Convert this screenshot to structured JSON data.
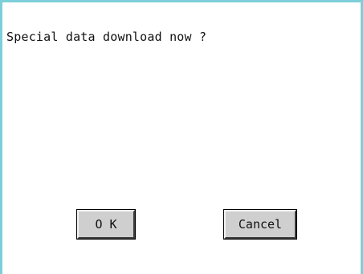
{
  "dialog": {
    "message": "Special data download now ?",
    "ok_label": "O K",
    "cancel_label": "Cancel"
  },
  "colors": {
    "border": "#7ccfd8",
    "background": "#ffffff",
    "button_face": "#cfcfcf",
    "text": "#111111"
  }
}
